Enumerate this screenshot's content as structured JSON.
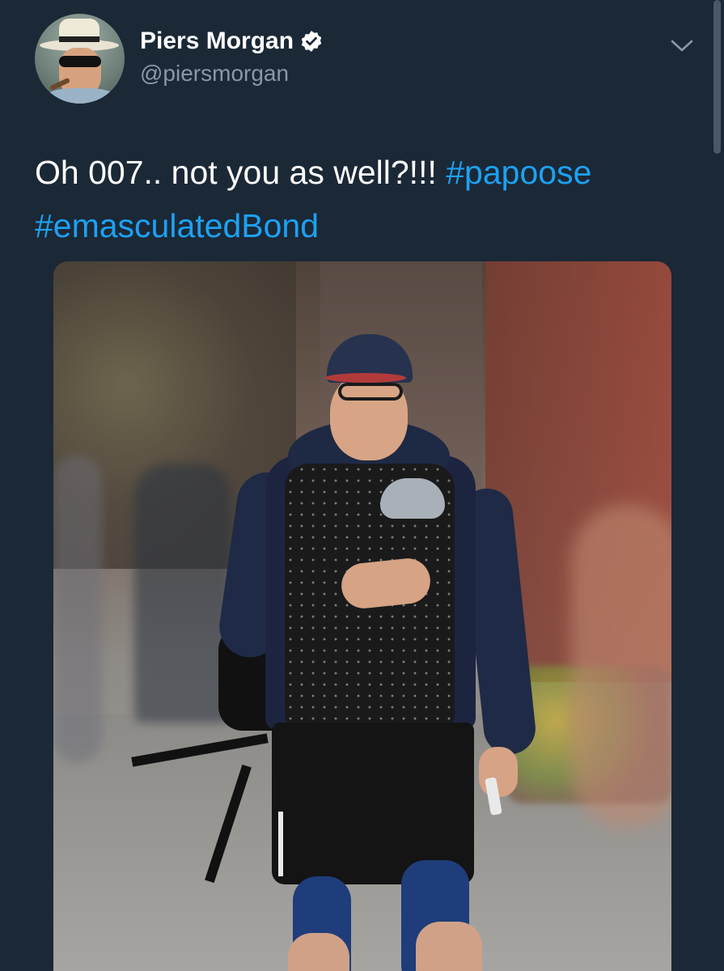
{
  "author": {
    "display_name": "Piers Morgan",
    "handle": "@piersmorgan",
    "verified": true,
    "avatar_icon": "avatar-photo"
  },
  "tweet": {
    "text_plain": "Oh 007.. not you as well?!!! ",
    "hashtags": [
      "#papoose",
      "#emasculatedBond"
    ]
  },
  "icons": {
    "verified": "verified-badge-icon",
    "menu": "chevron-down-icon"
  },
  "colors": {
    "background": "#1b2836",
    "link": "#1da1f2",
    "secondary_text": "#8899a6",
    "primary_text": "#ffffff"
  }
}
